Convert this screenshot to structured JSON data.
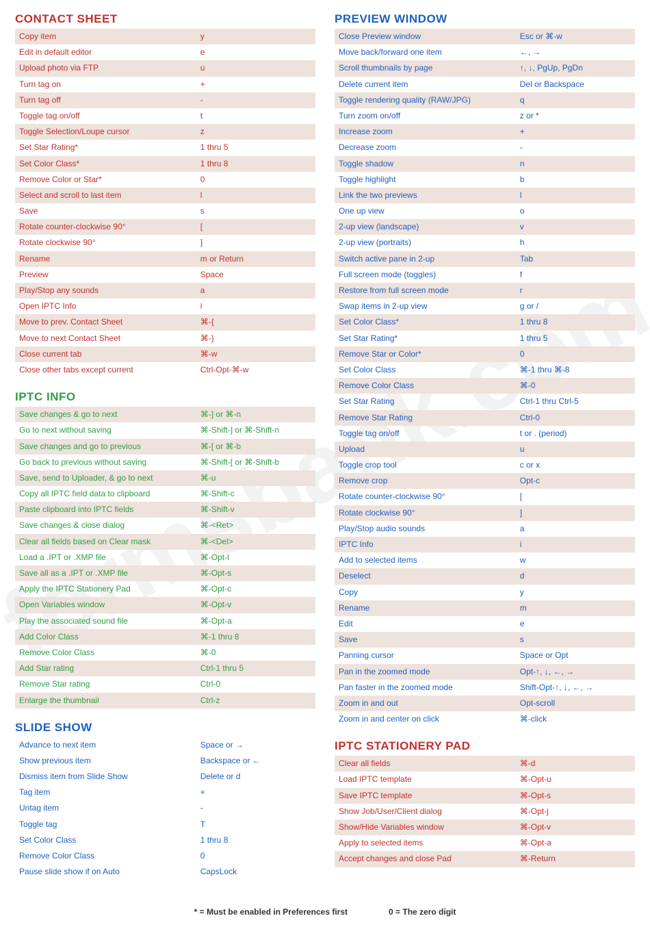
{
  "left": [
    {
      "title": "CONTACT SHEET",
      "color": "red",
      "rows": [
        [
          "Copy item",
          "y"
        ],
        [
          "Edit in default editor",
          "e"
        ],
        [
          "Upload photo via FTP",
          "u"
        ],
        [
          "Turn tag on",
          "+"
        ],
        [
          "Turn tag off",
          "-"
        ],
        [
          "Toggle tag on/off",
          "t"
        ],
        [
          "Toggle Selection/Loupe cursor",
          "z"
        ],
        [
          "Set Star Rating*",
          "1 thru 5"
        ],
        [
          "Set Color Class*",
          "1 thru 8"
        ],
        [
          "Remove Color or Star*",
          "0"
        ],
        [
          "Select and scroll to last item",
          "l"
        ],
        [
          "Save",
          "s"
        ],
        [
          "Rotate counter-clockwise 90°",
          "["
        ],
        [
          "Rotate clockwise 90°",
          "]"
        ],
        [
          "Rename",
          "m or Return"
        ],
        [
          "Preview",
          "Space"
        ],
        [
          "Play/Stop any sounds",
          "a"
        ],
        [
          "Open IPTC Info",
          "i"
        ],
        [
          "Move to prev. Contact Sheet",
          "⌘-{"
        ],
        [
          "Move to next Contact Sheet",
          "⌘-}"
        ],
        [
          "Close current tab",
          "⌘-w"
        ],
        [
          "Close other tabs except current",
          "Ctrl-Opt-⌘-w"
        ]
      ]
    },
    {
      "title": "IPTC INFO",
      "color": "green",
      "rows": [
        [
          "Save changes & go to next",
          "⌘-] or ⌘-n"
        ],
        [
          "Go to next without saving",
          "⌘-Shift-] or ⌘-Shift-n"
        ],
        [
          "Save changes and go to previous",
          "⌘-[ or ⌘-b"
        ],
        [
          "Go back to previous without saving",
          "⌘-Shift-[ or ⌘-Shift-b"
        ],
        [
          "Save, send to Uploader, & go to next",
          "⌘-u"
        ],
        [
          "Copy all IPTC field data to clipboard",
          "⌘-Shift-c"
        ],
        [
          "Paste clipboard into IPTC fields",
          "⌘-Shift-v"
        ],
        [
          "Save changes & close dialog",
          "⌘-<Ret>"
        ],
        [
          "Clear all fields based on Clear mask",
          "⌘-<Del>"
        ],
        [
          "Load a .IPT or .XMP file",
          "⌘-Opt-l"
        ],
        [
          "Save all as a .IPT or .XMP file",
          "⌘-Opt-s"
        ],
        [
          "Apply the IPTC Stationery Pad",
          "⌘-Opt-c"
        ],
        [
          "Open Variables window",
          "⌘-Opt-v"
        ],
        [
          "Play the associated sound file",
          "⌘-Opt-a"
        ],
        [
          "Add Color Class",
          "⌘-1 thru 8"
        ],
        [
          "Remove Color Class",
          "⌘-0"
        ],
        [
          "Add Star rating",
          "Ctrl-1 thru 5"
        ],
        [
          "Remove Star rating",
          "Ctrl-0"
        ],
        [
          "Enlarge the thumbnail",
          "Ctrl-z"
        ]
      ]
    },
    {
      "title": "SLIDE SHOW",
      "color": "blue",
      "nobg": true,
      "rows": [
        [
          "Advance to next item",
          "Space or →"
        ],
        [
          "Show previous item",
          "Backspace or ←"
        ],
        [
          "Dismiss item from Slide Show",
          "Delete or d"
        ],
        [
          "Tag item",
          "+"
        ],
        [
          "Untag item",
          "-"
        ],
        [
          "Toggle tag",
          "T"
        ],
        [
          "Set Color Class",
          "1 thru 8"
        ],
        [
          "Remove Color Class",
          "0"
        ],
        [
          "Pause slide show if on Auto",
          "CapsLock"
        ]
      ]
    }
  ],
  "right": [
    {
      "title": "PREVIEW WINDOW",
      "color": "blue",
      "rows": [
        [
          "Close Preview window",
          "Esc or ⌘-w"
        ],
        [
          "Move back/forward one item",
          "←, →"
        ],
        [
          "Scroll thumbnails by page",
          "↑, ↓, PgUp, PgDn"
        ],
        [
          "Delete current item",
          "Del or Backspace"
        ],
        [
          "Toggle rendering quality (RAW/JPG)",
          "q"
        ],
        [
          "Turn zoom on/off",
          "z or *"
        ],
        [
          "Increase zoom",
          "+"
        ],
        [
          "Decrease zoom",
          "-"
        ],
        [
          "Toggle shadow",
          "n"
        ],
        [
          "Toggle highlight",
          "b"
        ],
        [
          "Link the two previews",
          "l"
        ],
        [
          "One up view",
          "o"
        ],
        [
          "2-up view (landscape)",
          "v"
        ],
        [
          "2-up view (portraits)",
          "h"
        ],
        [
          "Switch active pane in 2-up",
          "Tab"
        ],
        [
          "Full screen mode (toggles)",
          "f"
        ],
        [
          "Restore from full screen mode",
          "r"
        ],
        [
          "Swap items in 2-up view",
          "g or /"
        ],
        [
          "Set Color Class*",
          "1 thru 8"
        ],
        [
          "Set Star Rating*",
          "1 thru 5"
        ],
        [
          "Remove Star or Color*",
          "0"
        ],
        [
          "Set Color Class",
          "⌘-1 thru ⌘-8"
        ],
        [
          "Remove Color Class",
          "⌘-0"
        ],
        [
          "Set Star Rating",
          "Ctrl-1 thru Ctrl-5"
        ],
        [
          "Remove Star Rating",
          "Ctrl-0"
        ],
        [
          "Toggle tag on/off",
          "t or . (period)"
        ],
        [
          "Upload",
          "u"
        ],
        [
          "Toggle crop tool",
          "c or x"
        ],
        [
          "Remove crop",
          "Opt-c"
        ],
        [
          "Rotate counter-clockwise 90°",
          "["
        ],
        [
          "Rotate clockwise 90°",
          "]"
        ],
        [
          "Play/Stop audio sounds",
          "a"
        ],
        [
          "IPTC Info",
          "i"
        ],
        [
          "Add to selected items",
          "w"
        ],
        [
          "Deselect",
          "d"
        ],
        [
          "Copy",
          "y"
        ],
        [
          "Rename",
          "m"
        ],
        [
          "Edit",
          "e"
        ],
        [
          "Save",
          "s"
        ],
        [
          "Panning cursor",
          "Space or Opt"
        ],
        [
          "Pan in the zoomed mode",
          "Opt-↑, ↓, ←, →"
        ],
        [
          "Pan faster in the zoomed mode",
          "Shift-Opt-↑, ↓, ←, →"
        ],
        [
          "Zoom in and out",
          "Opt-scroll"
        ],
        [
          "Zoom in and center on click",
          "⌘-click"
        ]
      ]
    },
    {
      "title": "IPTC STATIONERY PAD",
      "color": "red",
      "rows": [
        [
          "Clear all fields",
          "⌘-d"
        ],
        [
          "Load IPTC template",
          "⌘-Opt-u"
        ],
        [
          "Save IPTC template",
          "⌘-Opt-s"
        ],
        [
          "Show Job/User/Client dialog",
          "⌘-Opt-j"
        ],
        [
          "Show/Hide Variables window",
          "⌘-Opt-v"
        ],
        [
          "Apply to selected items",
          "⌘-Opt-a"
        ],
        [
          "Accept changes and close Pad",
          "⌘-Return"
        ]
      ]
    }
  ],
  "footnotes": {
    "a": "* = Must be enabled in Preferences first",
    "b": "0 = The zero digit"
  },
  "watermark": "formsbank.com"
}
